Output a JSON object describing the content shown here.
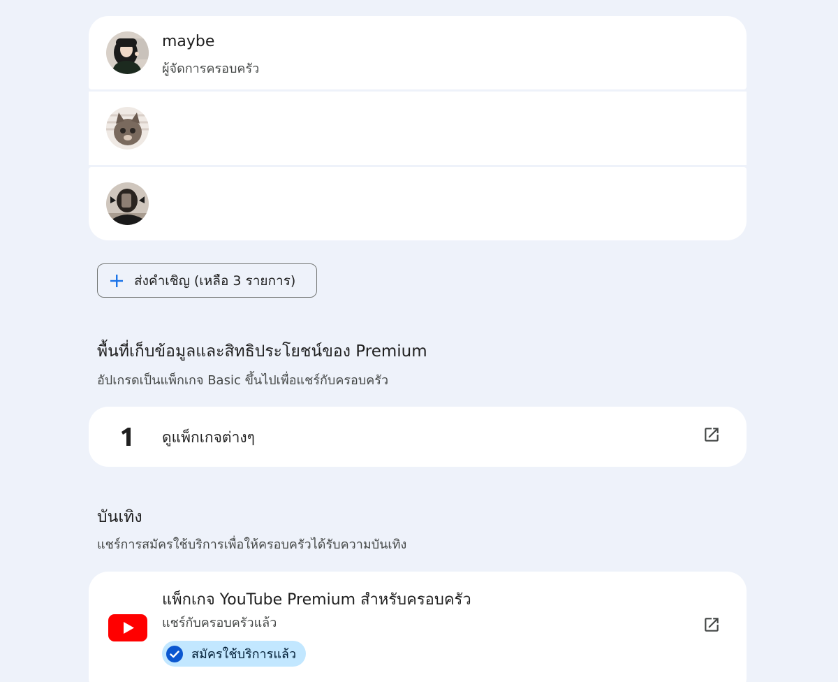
{
  "members": [
    {
      "name": "maybe",
      "role": "ผู้จัดการครอบครัว",
      "avatar": "avatar-photo-woman-icon"
    },
    {
      "name": "",
      "role": "",
      "avatar": "avatar-photo-cat-icon"
    },
    {
      "name": "",
      "role": "",
      "avatar": "avatar-photo-mirror-selfie-icon"
    }
  ],
  "invite": {
    "label": "ส่งคำเชิญ (เหลือ 3 รายการ)",
    "icon": "plus-icon",
    "icon_color": "#1a73e8"
  },
  "storage_section": {
    "title": "พื้นที่เก็บข้อมูลและสิทธิประโยชน์ของ Premium",
    "subtitle": "อัปเกรดเป็นแพ็กเกจ Basic ขึ้นไปเพื่อแชร์กับครอบครัว",
    "item": {
      "label": "ดูแพ็กเกจต่างๆ",
      "icon": "google-one-icon",
      "action_icon": "open-external-icon"
    }
  },
  "entertainment_section": {
    "title": "บันเทิง",
    "subtitle": "แชร์การสมัครใช้บริการเพื่อให้ครอบครัวได้รับความบันเทิง",
    "item": {
      "title": "แพ็กเกจ YouTube Premium สำหรับครอบครัว",
      "subtitle": "แชร์กับครอบครัวแล้ว",
      "badge": "สมัครใช้บริการแล้ว",
      "icon": "youtube-icon",
      "action_icon": "open-external-icon"
    }
  },
  "colors": {
    "background": "#eef2fa",
    "card": "#ffffff",
    "youtube_red": "#ff0000",
    "badge_bg": "#c2e7ff",
    "badge_check": "#0b57d0"
  }
}
